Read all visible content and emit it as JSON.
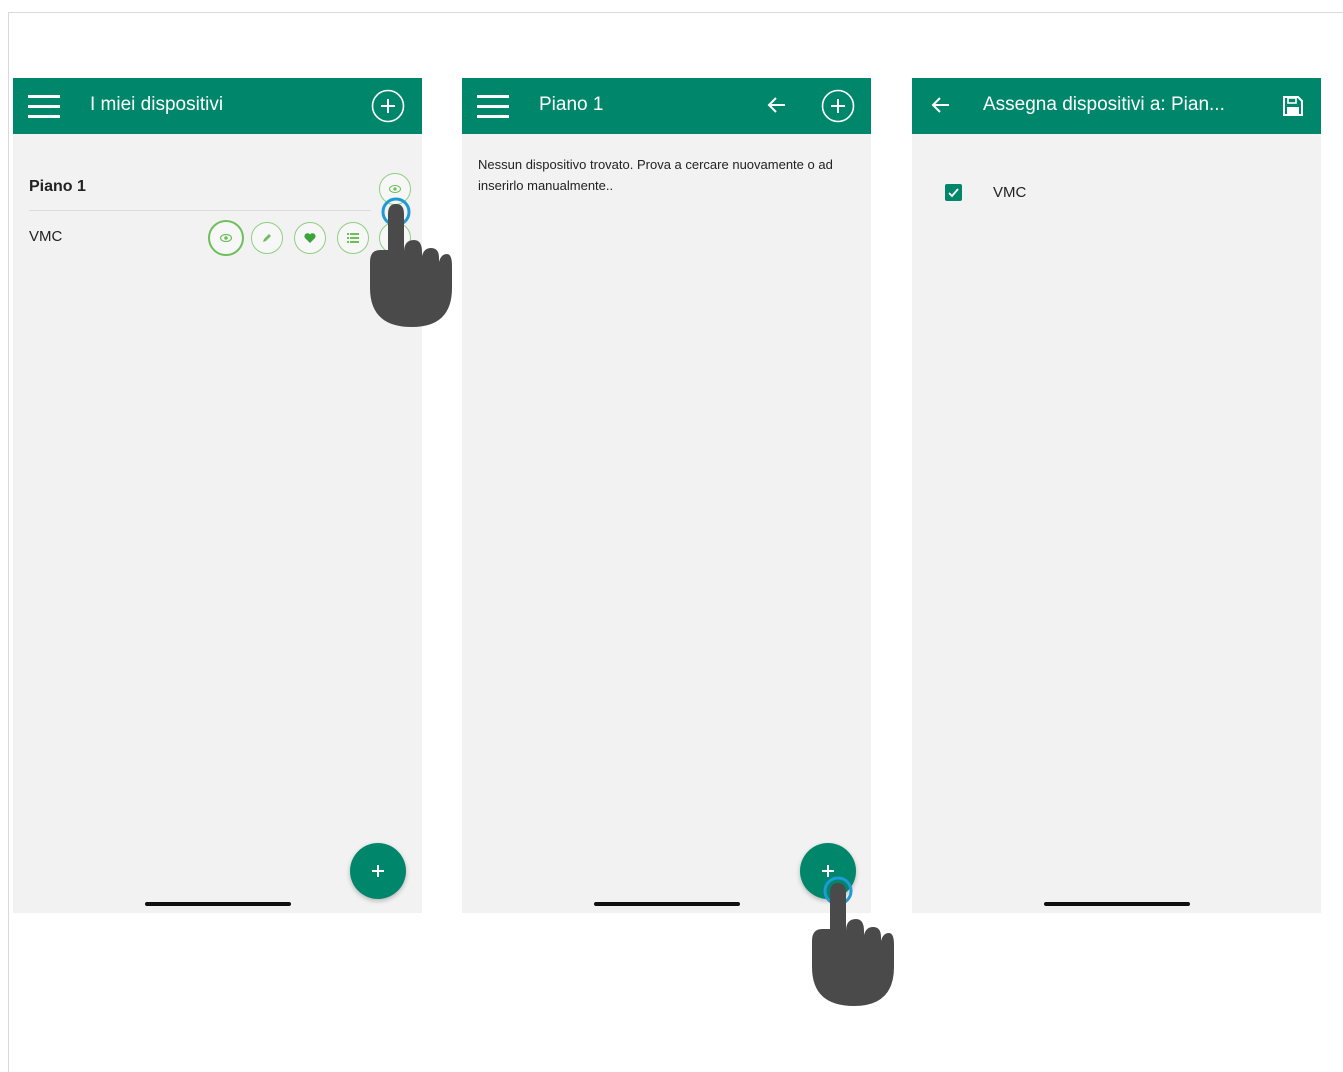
{
  "screen1": {
    "title": "I miei dispositivi",
    "group_name": "Piano 1",
    "device_name": "VMC",
    "icons": [
      "menu-icon",
      "add-circle-icon",
      "eye-icon",
      "pencil-icon",
      "heart-icon",
      "list-icon",
      "add-icon"
    ]
  },
  "screen2": {
    "title": "Piano 1",
    "empty_message": "Nessun dispositivo trovato. Prova a cercare nuovamente o ad inserirlo manualmente..",
    "icons": [
      "menu-icon",
      "arrow-left-icon",
      "add-circle-icon",
      "add-icon"
    ]
  },
  "screen3": {
    "title": "Assegna dispositivi a: Pian...",
    "device_name": "VMC",
    "device_checked": true,
    "icons": [
      "arrow-left-icon",
      "save-icon",
      "checkbox-checked-icon"
    ]
  },
  "colors": {
    "appbar": "#00876b",
    "background": "#f2f2f2",
    "accent_green": "#6dbf5a",
    "tap_ring": "#1e9ad6",
    "hand": "#4a4a4a"
  }
}
